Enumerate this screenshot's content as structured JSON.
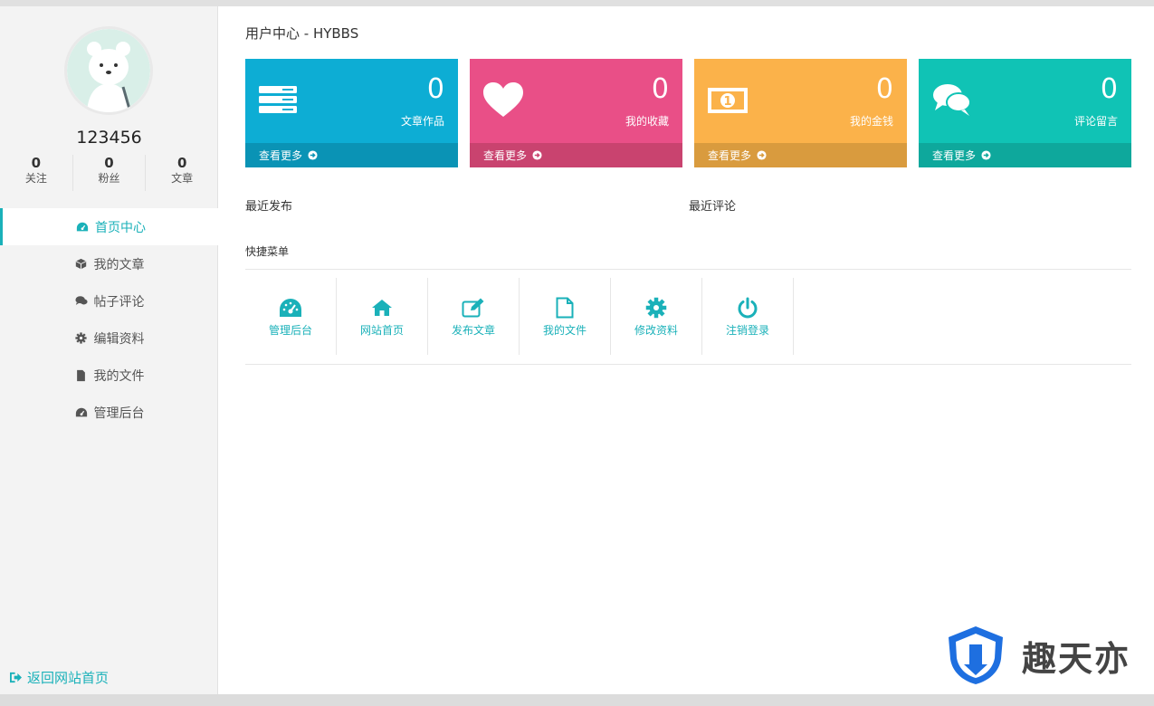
{
  "colors": {
    "accent": "#1ab1b9",
    "card_blue": "#0dadd4",
    "card_pink": "#e94f87",
    "card_orange": "#fbb24a",
    "card_teal": "#10c3b5"
  },
  "profile": {
    "username": "123456",
    "stats": [
      {
        "value": "0",
        "label": "关注"
      },
      {
        "value": "0",
        "label": "粉丝"
      },
      {
        "value": "0",
        "label": "文章"
      }
    ]
  },
  "nav": {
    "items": [
      {
        "label": "首页中心",
        "icon": "dashboard-icon",
        "active": true
      },
      {
        "label": "我的文章",
        "icon": "cube-icon"
      },
      {
        "label": "帖子评论",
        "icon": "comments-icon"
      },
      {
        "label": "编辑资料",
        "icon": "gear-icon"
      },
      {
        "label": "我的文件",
        "icon": "file-icon"
      },
      {
        "label": "管理后台",
        "icon": "dashboard-icon"
      }
    ],
    "back_home": "返回网站首页"
  },
  "header": {
    "title": "用户中心 - HYBBS"
  },
  "cards": [
    {
      "count": "0",
      "label": "文章作品",
      "more": "查看更多",
      "icon": "server-icon"
    },
    {
      "count": "0",
      "label": "我的收藏",
      "more": "查看更多",
      "icon": "heart-icon"
    },
    {
      "count": "0",
      "label": "我的金钱",
      "more": "查看更多",
      "icon": "money-icon"
    },
    {
      "count": "0",
      "label": "评论留言",
      "more": "查看更多",
      "icon": "comments-icon"
    }
  ],
  "sections": {
    "recent_posts": "最近发布",
    "recent_comments": "最近评论",
    "quick_menu": "快捷菜单"
  },
  "quick_menu": [
    {
      "label": "管理后台",
      "icon": "dashboard-icon"
    },
    {
      "label": "网站首页",
      "icon": "home-icon"
    },
    {
      "label": "发布文章",
      "icon": "edit-icon"
    },
    {
      "label": "我的文件",
      "icon": "file-icon"
    },
    {
      "label": "修改资料",
      "icon": "gear-icon"
    },
    {
      "label": "注销登录",
      "icon": "power-icon"
    }
  ],
  "watermark": {
    "text": "趣天亦"
  }
}
